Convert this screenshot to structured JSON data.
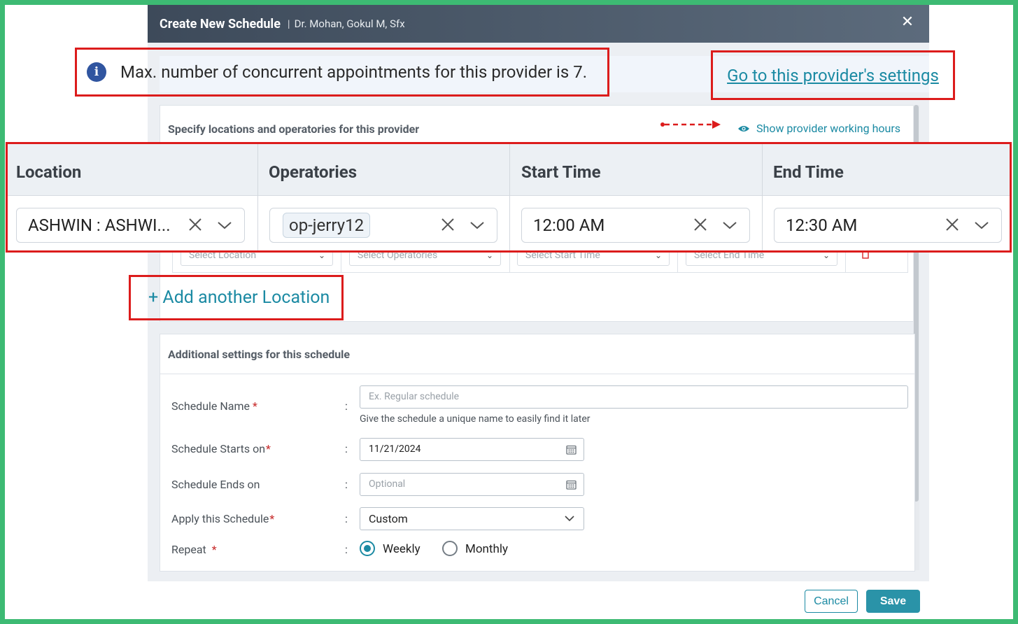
{
  "modal": {
    "title": "Create New Schedule",
    "separator": "|",
    "subtitle": "Dr. Mohan, Gokul M, Sfx",
    "close_icon": "close-icon"
  },
  "info": {
    "icon": "info-icon",
    "icon_glyph": "i",
    "message": "Max. number of concurrent appointments for this provider is 7.",
    "settings_link": "Go to this provider's settings"
  },
  "locations": {
    "title": "Specify locations and operatories for this provider",
    "working_hours_link": "Show provider working hours",
    "columns": [
      "Location",
      "Operatories",
      "Start Time",
      "End Time"
    ],
    "row": {
      "location": "ASHWIN : ASHWI...",
      "operatory": "op-jerry12",
      "start_time": "12:00 AM",
      "end_time": "12:30 AM"
    },
    "blank_row": {
      "location_placeholder": "Select Location",
      "operatory_placeholder": "Select Operatories",
      "start_placeholder": "Select Start Time",
      "end_placeholder": "Select End Time"
    },
    "add_link": "+ Add another Location"
  },
  "additional": {
    "title": "Additional settings for this schedule",
    "colon": ":",
    "schedule_name": {
      "label": "Schedule Name",
      "required": "*",
      "placeholder": "Ex. Regular schedule",
      "hint": "Give the schedule a unique name to easily find it later"
    },
    "starts_on": {
      "label": "Schedule Starts on",
      "required": "*",
      "value": "11/21/2024"
    },
    "ends_on": {
      "label": "Schedule Ends on",
      "placeholder": "Optional"
    },
    "apply": {
      "label": "Apply this Schedule",
      "required": "*",
      "value": "Custom"
    },
    "repeat": {
      "label": "Repeat",
      "required": "*",
      "options": [
        "Weekly",
        "Monthly"
      ],
      "selected": "Weekly"
    }
  },
  "footer": {
    "cancel": "Cancel",
    "save": "Save"
  },
  "colors": {
    "accent": "#1b8aa3",
    "highlight": "#dc1c1c",
    "frame": "#3dba73",
    "header": "#3d4a5a"
  }
}
